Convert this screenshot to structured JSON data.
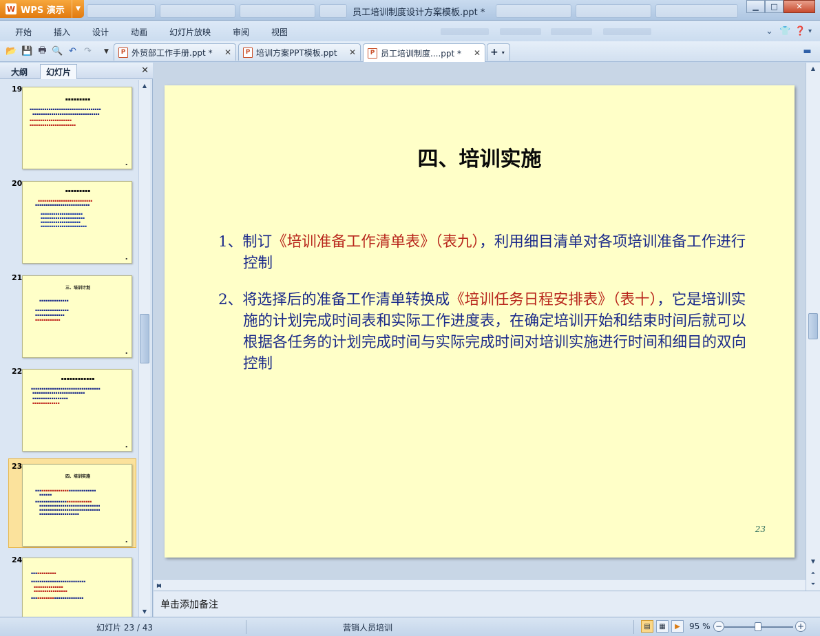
{
  "app": {
    "logo_label": "WPS 演示",
    "window_title": "员工培训制度设计方案模板.ppt *"
  },
  "menu": [
    "开始",
    "插入",
    "设计",
    "动画",
    "幻灯片放映",
    "审阅",
    "视图"
  ],
  "doc_tabs": [
    {
      "label": "外贸部工作手册.ppt *",
      "active": false
    },
    {
      "label": "培训方案PPT模板.ppt",
      "active": false
    },
    {
      "label": "员工培训制度....ppt *",
      "active": true
    }
  ],
  "side_panel": {
    "tabs": [
      "大纲",
      "幻灯片"
    ],
    "thumbnails": [
      {
        "num": "19",
        "title": "",
        "selected": false
      },
      {
        "num": "20",
        "title": "",
        "selected": false
      },
      {
        "num": "21",
        "title": "三、培训计划",
        "selected": false
      },
      {
        "num": "22",
        "title": "",
        "selected": false
      },
      {
        "num": "23",
        "title": "四、培训实施",
        "selected": true
      },
      {
        "num": "24",
        "title": "",
        "selected": false
      }
    ]
  },
  "slide": {
    "title": "四、培训实施",
    "items": [
      {
        "prefix": "1、制订",
        "highlight": "《培训准备工作清单表》（表九）",
        "suffix": "，利用细目清单对各项培训准备工作进行控制"
      },
      {
        "prefix": "2、将选择后的准备工作清单转换成",
        "highlight": "《培训任务日程安排表》（表十）",
        "suffix": "，它是培训实施的计划完成时间表和实际工作进度表，在确定培训开始和结束时间后就可以根据各任务的计划完成时间与实际完成时间对培训实施进行时间和细目的双向控制"
      }
    ],
    "number": "23"
  },
  "notes_placeholder": "单击添加备注",
  "status": {
    "slide_counter": "幻灯片 23 / 43",
    "theme_name": "营销人员培训",
    "zoom": "95 %"
  },
  "colors": {
    "slide_bg": "#ffffc8",
    "body_text": "#1b2a8a",
    "highlight_text": "#b8261c",
    "wps_orange": "#e88a1f"
  }
}
